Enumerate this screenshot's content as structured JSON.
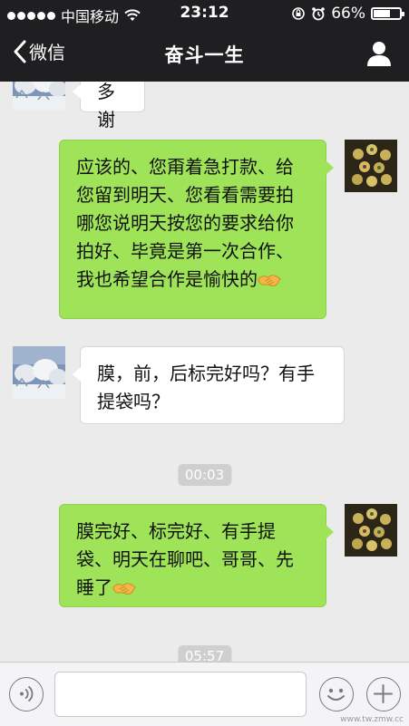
{
  "status_bar": {
    "carrier": "中国移动",
    "time": "23:12",
    "battery": "66%",
    "battery_level": 0.66
  },
  "nav": {
    "back_label": "微信",
    "title": "奋斗一生"
  },
  "messages": [
    {
      "side": "in",
      "text": "多谢",
      "avatar": "snow-scene"
    },
    {
      "side": "out",
      "text": "应该的、您甭着急打款、给您留到明天、您看看需要拍哪您说明天按您的要求给你拍好、毕竟是第一次合作、我也希望合作是愉快的",
      "emoji": "handshake-emoji",
      "avatar": "bells-ornament"
    },
    {
      "side": "in",
      "text": "膜，前，后标完好吗？有手提袋吗？",
      "avatar": "snow-scene"
    },
    {
      "time": "00:03"
    },
    {
      "side": "out",
      "text": "膜完好、标完好、有手提袋、明天在聊吧、哥哥、先睡了",
      "emoji": "handshake-emoji",
      "avatar": "bells-ornament"
    },
    {
      "time": "05:57"
    }
  ],
  "colors": {
    "header_bg": "#1f1f21",
    "chat_bg": "#ebebeb",
    "outgoing_bubble": "#9fe358",
    "incoming_bubble": "#ffffff"
  },
  "input_bar": {
    "icons": [
      "voice-icon",
      "emoji-icon",
      "plus-icon"
    ]
  },
  "watermark": "www.tw.zmw.cc"
}
